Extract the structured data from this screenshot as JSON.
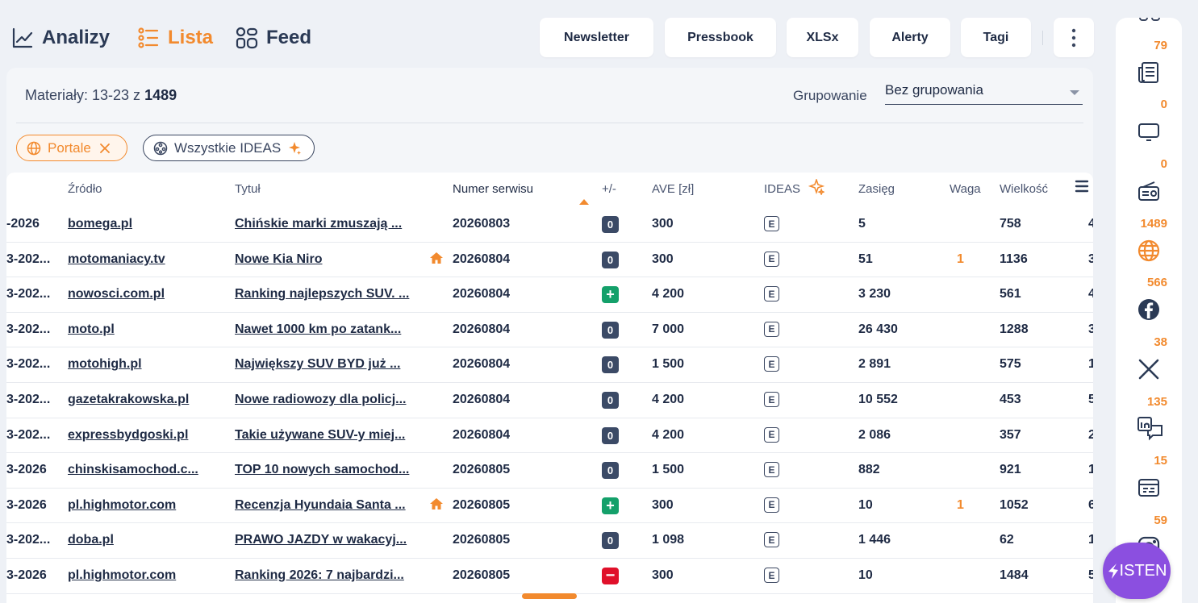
{
  "nav": {
    "tabs": [
      {
        "label": "Analizy",
        "icon": "chart-line-icon"
      },
      {
        "label": "Lista",
        "icon": "list-icon",
        "active": true
      },
      {
        "label": "Feed",
        "icon": "grid-icon"
      }
    ],
    "buttons": [
      "Newsletter",
      "Pressbook",
      "XLSx",
      "Alerty",
      "Tagi"
    ],
    "more_icon": "more-vertical-icon"
  },
  "summary": {
    "prefix": "Materiały: 13-23 z",
    "total": "1489"
  },
  "grouping": {
    "label": "Grupowanie",
    "value": "Bez grupowania"
  },
  "chips": [
    {
      "label": "Portale",
      "icon": "globe-icon",
      "close_icon": "close-icon"
    },
    {
      "label": "Wszystkie IDEAS",
      "icon": "ideas-icon",
      "sparkle_icon": "sparkle-icon"
    }
  ],
  "table": {
    "headers": [
      "Źródło",
      "Tytuł",
      "Numer serwisu",
      "+/-",
      "AVE [zł]",
      "IDEAS",
      "Zasięg",
      "Waga",
      "Wielkość"
    ],
    "rows": [
      {
        "date": "-2026",
        "source": "bomega.pl",
        "title": "Chińskie marki zmuszają ...",
        "home": false,
        "num": "20260803",
        "delta": "0",
        "delta_type": "zero",
        "ave": "300",
        "ideas": "E",
        "zasieg": "5",
        "waga": "",
        "wielkosc": "758",
        "extra": "4"
      },
      {
        "date": "3-202...",
        "source": "motomaniacy.tv",
        "title": "Nowe Kia Niro",
        "home": true,
        "num": "20260804",
        "delta": "0",
        "delta_type": "zero",
        "ave": "300",
        "ideas": "E",
        "zasieg": "51",
        "waga": "1",
        "wielkosc": "1136",
        "extra": "3"
      },
      {
        "date": "3-202...",
        "source": "nowosci.com.pl",
        "title": "Ranking najlepszych SUV. ...",
        "home": false,
        "num": "20260804",
        "delta": "+",
        "delta_type": "plus",
        "ave": "4 200",
        "ideas": "E",
        "zasieg": "3 230",
        "waga": "",
        "wielkosc": "561",
        "extra": "4"
      },
      {
        "date": "3-202...",
        "source": "moto.pl",
        "title": "Nawet 1000 km po zatank...",
        "home": false,
        "num": "20260804",
        "delta": "0",
        "delta_type": "zero",
        "ave": "7 000",
        "ideas": "E",
        "zasieg": "26 430",
        "waga": "",
        "wielkosc": "1288",
        "extra": "3"
      },
      {
        "date": "3-202...",
        "source": "motohigh.pl",
        "title": "Największy SUV BYD już ...",
        "home": false,
        "num": "20260804",
        "delta": "0",
        "delta_type": "zero",
        "ave": "1 500",
        "ideas": "E",
        "zasieg": "2 891",
        "waga": "",
        "wielkosc": "575",
        "extra": "1"
      },
      {
        "date": "3-202...",
        "source": "gazetakrakowska.pl",
        "title": "Nowe radiowozy dla policj...",
        "home": false,
        "num": "20260804",
        "delta": "0",
        "delta_type": "zero",
        "ave": "4 200",
        "ideas": "E",
        "zasieg": "10 552",
        "waga": "",
        "wielkosc": "453",
        "extra": "5"
      },
      {
        "date": "3-202...",
        "source": "expressbydgoski.pl",
        "title": "Takie używane SUV-y miej...",
        "home": false,
        "num": "20260804",
        "delta": "0",
        "delta_type": "zero",
        "ave": "4 200",
        "ideas": "E",
        "zasieg": "2 086",
        "waga": "",
        "wielkosc": "357",
        "extra": "2"
      },
      {
        "date": "3-2026",
        "source": "chinskisamochod.c...",
        "title": "TOP 10 nowych samochod...",
        "home": false,
        "num": "20260805",
        "delta": "0",
        "delta_type": "zero",
        "ave": "1 500",
        "ideas": "E",
        "zasieg": "882",
        "waga": "",
        "wielkosc": "921",
        "extra": "1"
      },
      {
        "date": "3-2026",
        "source": "pl.highmotor.com",
        "title": "Recenzja Hyundaia Santa ...",
        "home": true,
        "num": "20260805",
        "delta": "+",
        "delta_type": "plus",
        "ave": "300",
        "ideas": "E",
        "zasieg": "10",
        "waga": "1",
        "wielkosc": "1052",
        "extra": "6"
      },
      {
        "date": "3-202...",
        "source": "doba.pl",
        "title": "PRAWO JAZDY w wakacyj...",
        "home": false,
        "num": "20260805",
        "delta": "0",
        "delta_type": "zero",
        "ave": "1 098",
        "ideas": "E",
        "zasieg": "1 446",
        "waga": "",
        "wielkosc": "62",
        "extra": "1"
      },
      {
        "date": "3-2026",
        "source": "pl.highmotor.com",
        "title": "Ranking 2026: 7 najbardzi...",
        "home": false,
        "num": "20260805",
        "delta": "−",
        "delta_type": "minus",
        "ave": "300",
        "ideas": "E",
        "zasieg": "10",
        "waga": "",
        "wielkosc": "1484",
        "extra": "5"
      }
    ]
  },
  "sidebar": {
    "items": [
      {
        "count": "79",
        "icon": "newspaper-icon"
      },
      {
        "count": "0",
        "icon": "tv-icon"
      },
      {
        "count": "0",
        "icon": "radio-icon"
      },
      {
        "count": "1489",
        "icon": "globe-icon",
        "active": true
      },
      {
        "count": "566",
        "icon": "facebook-icon"
      },
      {
        "count": "38",
        "icon": "x-icon"
      },
      {
        "count": "135",
        "icon": "linkedin-icon"
      },
      {
        "count": "15",
        "icon": "subtitles-icon"
      },
      {
        "count": "59",
        "icon": "instagram-icon"
      }
    ]
  },
  "assistant": {
    "label": "ISTEN"
  },
  "colors": {
    "accent": "#f28a2e",
    "text": "#1e2a44",
    "plus": "#14a06a",
    "minus": "#e0102a",
    "zero": "#3b4a66",
    "assistant": "#8b4fe0"
  }
}
